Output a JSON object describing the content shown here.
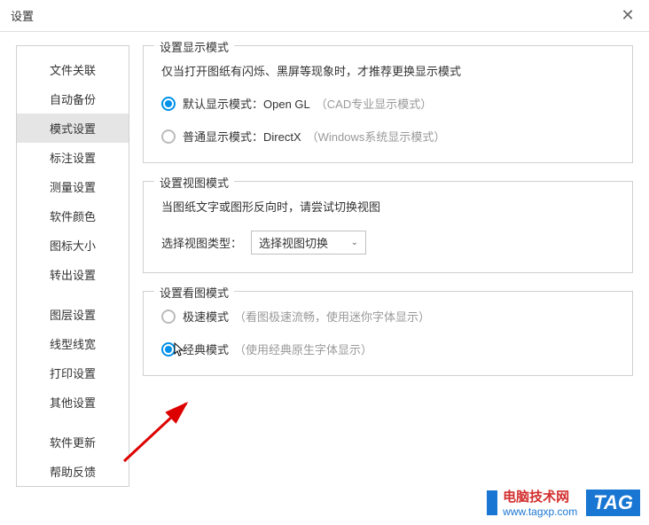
{
  "header": {
    "title": "设置"
  },
  "sidebar": {
    "items": [
      {
        "label": "文件关联"
      },
      {
        "label": "自动备份"
      },
      {
        "label": "模式设置",
        "active": true
      },
      {
        "label": "标注设置"
      },
      {
        "label": "测量设置"
      },
      {
        "label": "软件颜色"
      },
      {
        "label": "图标大小"
      },
      {
        "label": "转出设置"
      },
      {
        "label": "图层设置"
      },
      {
        "label": "线型线宽"
      },
      {
        "label": "打印设置"
      },
      {
        "label": "其他设置"
      },
      {
        "label": "软件更新"
      },
      {
        "label": "帮助反馈"
      }
    ]
  },
  "display_mode": {
    "legend": "设置显示模式",
    "hint": "仅当打开图纸有闪烁、黑屏等现象时，才推荐更换显示模式",
    "options": [
      {
        "label": "默认显示模式：Open GL",
        "note": "（CAD专业显示模式）",
        "checked": true
      },
      {
        "label": "普通显示模式：DirectX",
        "note": "（Windows系统显示模式）",
        "checked": false
      }
    ]
  },
  "view_mode": {
    "legend": "设置视图模式",
    "hint": "当图纸文字或图形反向时，请尝试切换视图",
    "select_label": "选择视图类型：",
    "select_value": "选择视图切换"
  },
  "read_mode": {
    "legend": "设置看图模式",
    "options": [
      {
        "label": "极速模式",
        "note": "（看图极速流畅，使用迷你字体显示）",
        "checked": false
      },
      {
        "label": "经典模式",
        "note": "（使用经典原生字体显示）",
        "checked": true
      }
    ]
  },
  "watermark": {
    "title": "电脑技术网",
    "url": "www.tagxp.com",
    "tag": "TAG"
  }
}
